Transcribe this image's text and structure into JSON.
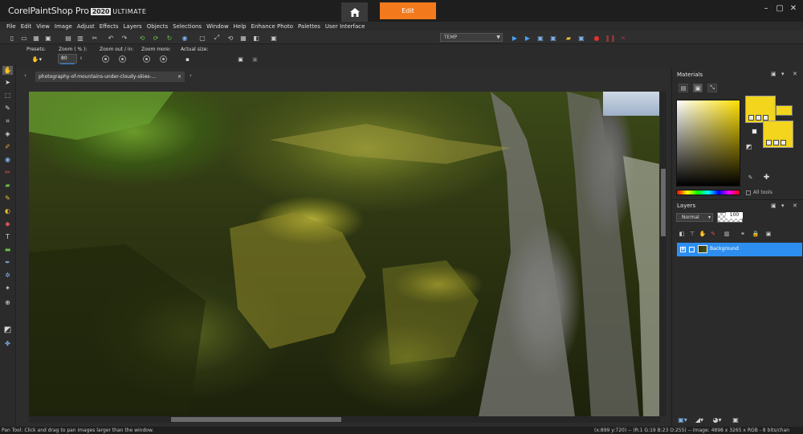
{
  "app": {
    "brand_pre": "Corel",
    "brand_name": "PaintShop Pro",
    "brand_year": "2020",
    "brand_edition": "ULTIMATE",
    "home_icon": "home-icon",
    "active_tab": "Edit",
    "accent_color": "#f27a1c"
  },
  "menu": [
    "File",
    "Edit",
    "View",
    "Image",
    "Adjust",
    "Effects",
    "Layers",
    "Objects",
    "Selections",
    "Window",
    "Help",
    "Enhance Photo",
    "Palettes",
    "User Interface"
  ],
  "toolbar": {
    "workspace_value": "TEMP"
  },
  "tool_options": {
    "presets_label": "Presets:",
    "zoom_label": "Zoom ( % ):",
    "zoom_value": "80",
    "zoom_out_in_label": "Zoom out / in:",
    "zoom_more_label": "Zoom more:",
    "actual_size_label": "Actual size:"
  },
  "document": {
    "tab_title": "photography-of-mountains-under-cloudy-skies-...",
    "close_symbol": "×",
    "tab_left_symbol": "‹",
    "tab_right_symbol": "›"
  },
  "status": {
    "text": "Pan Tool: Click and drag to pan images larger than the window.",
    "coords": "(x:899 y:720) -- (R:1 G:19 B:23 O:255) -- Image: 4898 x 3265 x RGB - 8 bits/chan"
  },
  "materials": {
    "title": "Materials",
    "all_tools_label": "All tools",
    "fg_color": "#f2d51c",
    "bg_color": "#f2d51c"
  },
  "layers": {
    "title": "Layers",
    "blend_mode": "Normal",
    "opacity": "100",
    "items": [
      {
        "name": "Background"
      }
    ]
  }
}
